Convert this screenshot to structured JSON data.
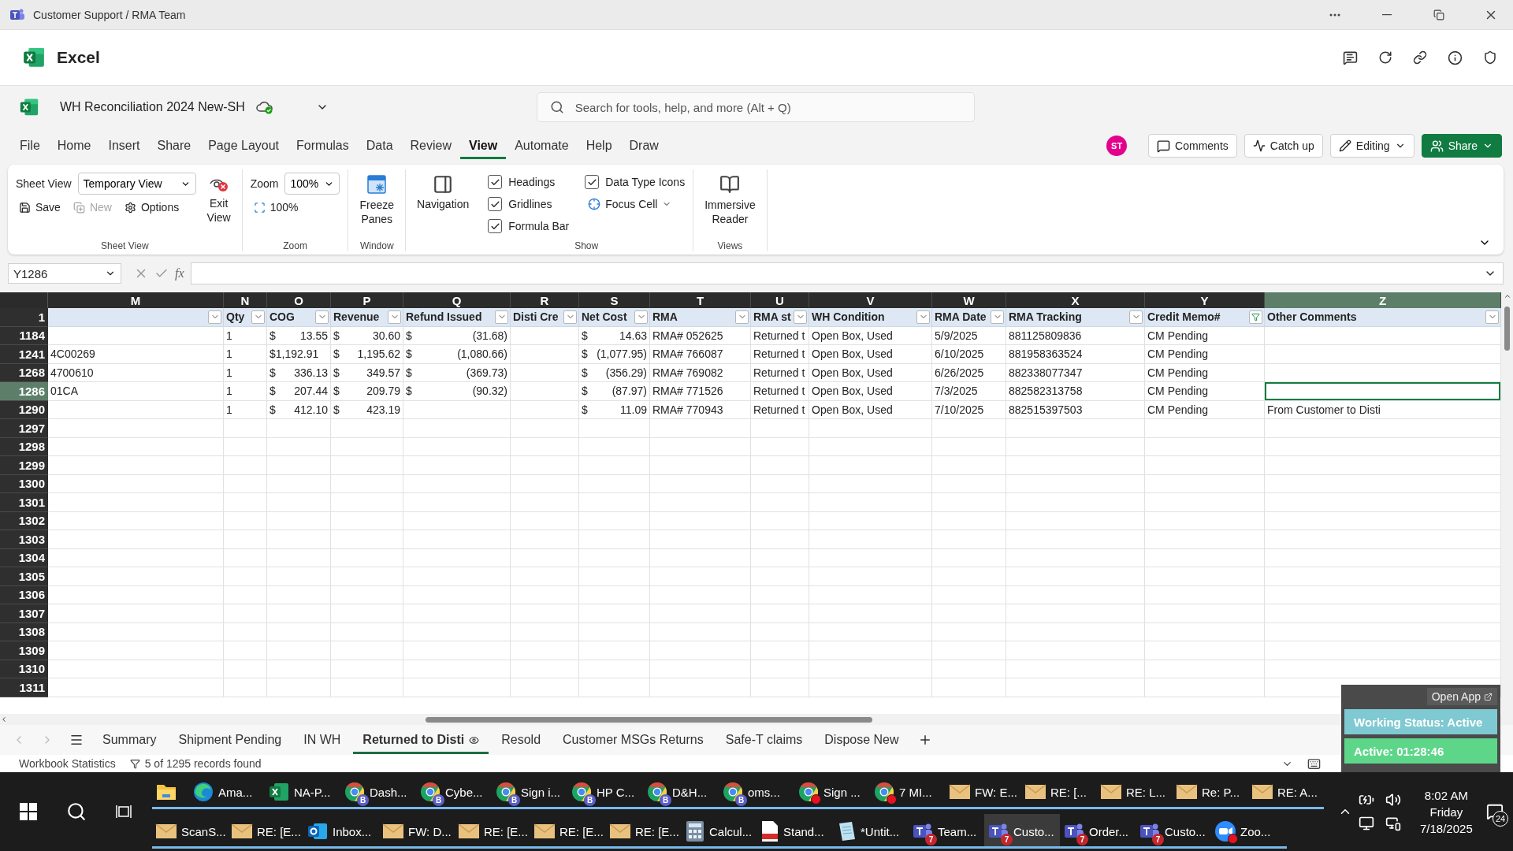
{
  "window": {
    "title": "Customer Support / RMA Team"
  },
  "app": {
    "name": "Excel"
  },
  "document": {
    "title": "WH Reconciliation 2024 New-SH"
  },
  "search": {
    "placeholder": "Search for tools, help, and more (Alt + Q)"
  },
  "menu_tabs": [
    {
      "label": "File",
      "selected": false
    },
    {
      "label": "Home",
      "selected": false
    },
    {
      "label": "Insert",
      "selected": false
    },
    {
      "label": "Share",
      "selected": false
    },
    {
      "label": "Page Layout",
      "selected": false
    },
    {
      "label": "Formulas",
      "selected": false
    },
    {
      "label": "Data",
      "selected": false
    },
    {
      "label": "Review",
      "selected": false
    },
    {
      "label": "View",
      "selected": true
    },
    {
      "label": "Automate",
      "selected": false
    },
    {
      "label": "Help",
      "selected": false
    },
    {
      "label": "Draw",
      "selected": false
    }
  ],
  "avatar": {
    "initials": "ST"
  },
  "header_buttons": [
    {
      "kind": "comments",
      "label": "Comments"
    },
    {
      "kind": "catchup",
      "label": "Catch up"
    },
    {
      "kind": "editing",
      "label": "Editing"
    },
    {
      "kind": "share",
      "label": "Share"
    }
  ],
  "ribbon": {
    "sheet_view": {
      "field_label": "Sheet View",
      "view": "Temporary View",
      "save": "Save",
      "new": {
        "label": "New",
        "disabled": true
      },
      "options": "Options",
      "exit": "Exit View",
      "group": "Sheet View"
    },
    "zoom": {
      "field_label": "Zoom",
      "value": "100%",
      "reset": "100%",
      "group": "Zoom"
    },
    "window": {
      "freeze": "Freeze Panes",
      "group": "Window"
    },
    "navigation": "Navigation",
    "show": {
      "checks": [
        {
          "label": "Headings",
          "checked": true
        },
        {
          "label": "Gridlines",
          "checked": true
        },
        {
          "label": "Formula Bar",
          "checked": true
        },
        {
          "label": "Data Type Icons",
          "checked": true
        }
      ],
      "focus_cell": "Focus Cell",
      "group": "Show"
    },
    "views": {
      "reader": "Immersive Reader",
      "group": "Views"
    }
  },
  "formula_bar": {
    "name_box": "Y1286",
    "function_label": "fx"
  },
  "sheet": {
    "columns": [
      {
        "letter": "M",
        "selected": false
      },
      {
        "letter": "N",
        "selected": false
      },
      {
        "letter": "O",
        "selected": false
      },
      {
        "letter": "P",
        "selected": false
      },
      {
        "letter": "Q",
        "selected": false
      },
      {
        "letter": "R",
        "selected": false
      },
      {
        "letter": "S",
        "selected": false
      },
      {
        "letter": "T",
        "selected": false
      },
      {
        "letter": "U",
        "selected": false
      },
      {
        "letter": "V",
        "selected": false
      },
      {
        "letter": "W",
        "selected": false
      },
      {
        "letter": "X",
        "selected": false
      },
      {
        "letter": "Y",
        "selected": false
      },
      {
        "letter": "Z",
        "selected": true
      }
    ],
    "header_row": {
      "number": "1",
      "cells": [
        {
          "filtered": false
        },
        {
          "label": "Qty",
          "filtered": false
        },
        {
          "label": "COG",
          "filtered": false
        },
        {
          "label": "Revenue",
          "filtered": false
        },
        {
          "label": "Refund Issued",
          "filtered": false
        },
        {
          "label": "Disti Cre",
          "filtered": false
        },
        {
          "label": "Net Cost",
          "filtered": false
        },
        {
          "label": "RMA",
          "filtered": false
        },
        {
          "label": "RMA st",
          "filtered": false
        },
        {
          "label": "WH Condition",
          "filtered": false
        },
        {
          "label": "RMA Date",
          "filtered": false
        },
        {
          "label": "RMA Tracking",
          "filtered": false
        },
        {
          "label": "Credit Memo#",
          "filtered": true
        },
        {
          "label": "Other Comments",
          "filtered": false
        }
      ]
    },
    "rows": [
      {
        "number": "1184",
        "selected": false,
        "cells": [
          null,
          "1",
          {
            "symbol": "$",
            "amount": "13.55"
          },
          {
            "symbol": "$",
            "amount": "30.60"
          },
          {
            "symbol": "$",
            "amount": "(31.68)"
          },
          null,
          {
            "symbol": "$",
            "amount": "14.63"
          },
          "RMA# 052625",
          "Returned t",
          "Open Box, Used",
          "5/9/2025",
          "881125809836",
          "CM Pending",
          null
        ]
      },
      {
        "number": "1241",
        "selected": false,
        "cells": [
          "4C00269",
          "1",
          "$1,192.91",
          {
            "symbol": "$",
            "amount": "1,195.62"
          },
          {
            "symbol": "$",
            "amount": "(1,080.66)"
          },
          null,
          {
            "symbol": "$",
            "amount": "(1,077.95)"
          },
          "RMA# 766087",
          "Returned t",
          "Open Box, Used",
          "6/10/2025",
          "881958363524",
          "CM Pending",
          null
        ]
      },
      {
        "number": "1268",
        "selected": false,
        "cells": [
          "4700610",
          "1",
          {
            "symbol": "$",
            "amount": "336.13"
          },
          {
            "symbol": "$",
            "amount": "349.57"
          },
          {
            "symbol": "$",
            "amount": "(369.73)"
          },
          null,
          {
            "symbol": "$",
            "amount": "(356.29)"
          },
          "RMA# 769082",
          "Returned t",
          "Open Box, Used",
          "6/26/2025",
          "882338077347",
          "CM Pending",
          null
        ]
      },
      {
        "number": "1286",
        "selected": true,
        "cells": [
          "01CA",
          "1",
          {
            "symbol": "$",
            "amount": "207.44"
          },
          {
            "symbol": "$",
            "amount": "209.79"
          },
          {
            "symbol": "$",
            "amount": "(90.32)"
          },
          null,
          {
            "symbol": "$",
            "amount": "(87.97)"
          },
          "RMA# 771526",
          "Returned t",
          "Open Box, Used",
          "7/3/2025",
          "882582313758",
          "CM Pending",
          {
            "active": true
          }
        ]
      },
      {
        "number": "1290",
        "selected": false,
        "cells": [
          null,
          "1",
          {
            "symbol": "$",
            "amount": "412.10"
          },
          {
            "symbol": "$",
            "amount": "423.19"
          },
          null,
          null,
          {
            "symbol": "$",
            "amount": "11.09"
          },
          "RMA# 770943",
          "Returned t",
          "Open Box, Used",
          "7/10/2025",
          "882515397503",
          "CM Pending",
          "From Customer to Disti"
        ]
      },
      {
        "number": "1297",
        "selected": false
      },
      {
        "number": "1298",
        "selected": false
      },
      {
        "number": "1299",
        "selected": false
      },
      {
        "number": "1300",
        "selected": false
      },
      {
        "number": "1301",
        "selected": false
      },
      {
        "number": "1302",
        "selected": false
      },
      {
        "number": "1303",
        "selected": false
      },
      {
        "number": "1304",
        "selected": false
      },
      {
        "number": "1305",
        "selected": false
      },
      {
        "number": "1306",
        "selected": false
      },
      {
        "number": "1307",
        "selected": false
      },
      {
        "number": "1308",
        "selected": false
      },
      {
        "number": "1309",
        "selected": false
      },
      {
        "number": "1310",
        "selected": false
      },
      {
        "number": "1311",
        "selected": false
      }
    ]
  },
  "sheet_tabs": [
    {
      "label": "Summary",
      "selected": false
    },
    {
      "label": "Shipment Pending",
      "selected": false
    },
    {
      "label": "IN WH",
      "selected": false
    },
    {
      "label": "Returned to Disti",
      "selected": true
    },
    {
      "label": "Resold",
      "selected": false
    },
    {
      "label": "Customer MSGs Returns",
      "selected": false
    },
    {
      "label": "Safe-T claims",
      "selected": false
    },
    {
      "label": "Dispose New",
      "selected": false
    }
  ],
  "status_bar": {
    "label": "Workbook Statistics",
    "records": "5 of 1295 records found"
  },
  "widget": {
    "open_app": "Open App",
    "status": "Working Status: Active",
    "timer": "Active: 01:28:46"
  },
  "taskbar": {
    "rows": [
      [
        {
          "kind": "folder",
          "selected": false,
          "alert": false
        },
        {
          "kind": "edge",
          "label": "Ama...",
          "selected": false,
          "alert": false
        },
        {
          "kind": "excel",
          "label": "NA-P...",
          "selected": false,
          "alert": false
        },
        {
          "kind": "chrome",
          "label": "Dash...",
          "badge": "B",
          "selected": false,
          "alert": false
        },
        {
          "kind": "chrome",
          "label": "Cybe...",
          "badge": "B",
          "selected": false,
          "alert": false
        },
        {
          "kind": "chrome",
          "label": "Sign i...",
          "badge": "B",
          "selected": false,
          "alert": false
        },
        {
          "kind": "chrome",
          "label": "HP C...",
          "badge": "B",
          "selected": false,
          "alert": false
        },
        {
          "kind": "chrome",
          "label": "D&H...",
          "badge": "B",
          "selected": false,
          "alert": false
        },
        {
          "kind": "chrome",
          "label": "oms...",
          "badge": "B",
          "selected": false,
          "alert": false
        },
        {
          "kind": "chrome",
          "label": "Sign ...",
          "selected": false,
          "alert": true
        },
        {
          "kind": "chrome",
          "label": "7 MI...",
          "selected": false,
          "alert": true
        },
        {
          "kind": "mail",
          "label": "FW: E...",
          "selected": false,
          "alert": false
        },
        {
          "kind": "mail",
          "label": "RE: [...",
          "selected": false,
          "alert": false
        },
        {
          "kind": "mail",
          "label": "RE: L...",
          "selected": false,
          "alert": false
        },
        {
          "kind": "mail",
          "label": "Re: P...",
          "selected": false,
          "alert": false
        },
        {
          "kind": "mail",
          "label": "RE: A...",
          "selected": false,
          "alert": false
        }
      ],
      [
        {
          "kind": "mail",
          "label": "ScanS...",
          "selected": false,
          "alert": false
        },
        {
          "kind": "mail",
          "label": "RE: [E...",
          "selected": false,
          "alert": false
        },
        {
          "kind": "outlook",
          "label": "Inbox...",
          "selected": false,
          "alert": false
        },
        {
          "kind": "mail",
          "label": "FW: D...",
          "selected": false,
          "alert": false
        },
        {
          "kind": "mail",
          "label": "RE: [E...",
          "selected": false,
          "alert": false
        },
        {
          "kind": "mail",
          "label": "RE: [E...",
          "selected": false,
          "alert": false
        },
        {
          "kind": "mail",
          "label": "RE: [E...",
          "selected": false,
          "alert": false
        },
        {
          "kind": "calc",
          "label": "Calcul...",
          "selected": false,
          "alert": false
        },
        {
          "kind": "pdf",
          "label": "Stand...",
          "selected": false,
          "alert": false
        },
        {
          "kind": "notepad",
          "label": "*Untit...",
          "selected": false,
          "alert": false
        },
        {
          "kind": "teams",
          "label": "Team...",
          "badge": "7",
          "selected": false,
          "alert": false
        },
        {
          "kind": "teams",
          "label": "Custo...",
          "badge": "7",
          "selected": true,
          "alert": false
        },
        {
          "kind": "teams",
          "label": "Order...",
          "badge": "7",
          "selected": false,
          "alert": false
        },
        {
          "kind": "teams",
          "label": "Custo...",
          "badge": "7",
          "selected": false,
          "alert": false
        },
        {
          "kind": "zoom",
          "label": "Zoo...",
          "selected": false,
          "alert": true
        }
      ]
    ],
    "tray": {
      "time": "8:02 AM",
      "day": "Friday",
      "date": "7/18/2025",
      "notifications": "24"
    }
  }
}
